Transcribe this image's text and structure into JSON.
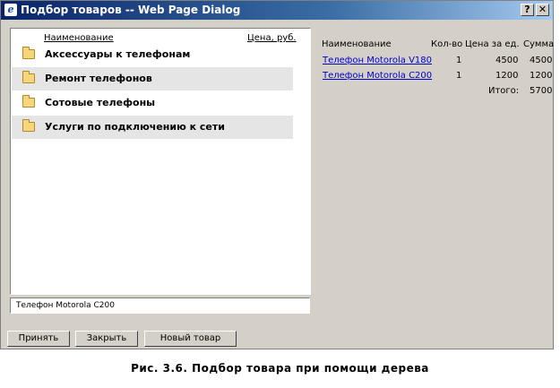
{
  "window": {
    "title": "Подбор товаров -- Web Page Dialog",
    "help_label": "?",
    "close_label": "✕"
  },
  "tree": {
    "column_name": "Наименование",
    "column_price": "Цена, руб.",
    "items": [
      {
        "label": "Аксессуары к телефонам"
      },
      {
        "label": "Ремонт телефонов"
      },
      {
        "label": "Сотовые телефоны"
      },
      {
        "label": "Услуги по подключению к сети"
      }
    ]
  },
  "detail": {
    "value": "Телефон Motorola C200"
  },
  "cart": {
    "headers": {
      "name": "Наименование",
      "qty": "Кол-во",
      "price": "Цена за ед.",
      "sum": "Сумма"
    },
    "rows": [
      {
        "name": "Телефон Motorola V180",
        "qty": "1",
        "price": "4500",
        "sum": "4500"
      },
      {
        "name": "Телефон Motorola C200",
        "qty": "1",
        "price": "1200",
        "sum": "1200"
      }
    ],
    "total_label": "Итого:",
    "total_value": "5700"
  },
  "buttons": {
    "accept": "Принять",
    "close": "Закрыть",
    "new_item": "Новый товар"
  },
  "caption": "Рис. 3.6. Подбор товара при помощи дерева"
}
